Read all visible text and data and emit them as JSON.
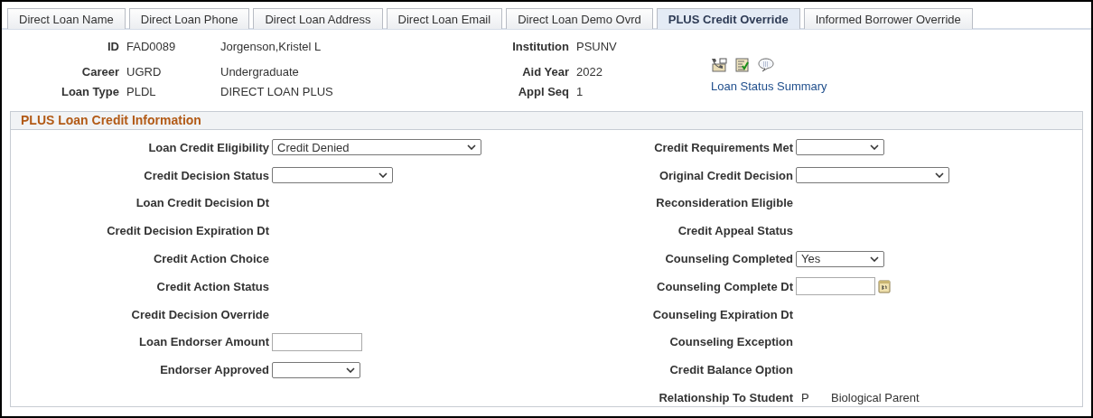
{
  "tabs": [
    {
      "label": "Direct Loan Name",
      "selected": false
    },
    {
      "label": "Direct Loan Phone",
      "selected": false
    },
    {
      "label": "Direct Loan Address",
      "selected": false
    },
    {
      "label": "Direct Loan Email",
      "selected": false
    },
    {
      "label": "Direct Loan Demo Ovrd",
      "selected": false
    },
    {
      "label": "PLUS Credit Override",
      "selected": true
    },
    {
      "label": "Informed Borrower Override",
      "selected": false
    }
  ],
  "header": {
    "left": [
      {
        "label": "ID",
        "code": "FAD0089",
        "description": "Jorgenson,Kristel L"
      },
      {
        "label": "Career",
        "code": "UGRD",
        "description": "Undergraduate"
      },
      {
        "label": "Loan Type",
        "code": "PLDL",
        "description": "DIRECT LOAN PLUS"
      }
    ],
    "right": [
      {
        "label": "Institution",
        "value": "PSUNV"
      },
      {
        "label": "Aid Year",
        "value": "2022"
      },
      {
        "label": "Appl Seq",
        "value": "1"
      }
    ],
    "link": "Loan Status Summary"
  },
  "section": {
    "title": "PLUS Loan Credit Information",
    "left_fields": [
      {
        "label": "Loan Credit Eligibility",
        "kind": "select",
        "value": "Credit Denied"
      },
      {
        "label": "Credit Decision Status",
        "kind": "select"
      },
      {
        "label": "Loan Credit Decision Dt",
        "kind": "display"
      },
      {
        "label": "Credit Decision Expiration Dt",
        "kind": "display"
      },
      {
        "label": "Credit Action Choice",
        "kind": "display"
      },
      {
        "label": "Credit Action Status",
        "kind": "display"
      },
      {
        "label": "Credit Decision Override",
        "kind": "display"
      },
      {
        "label": "Loan Endorser Amount",
        "kind": "text"
      },
      {
        "label": "Endorser Approved",
        "kind": "select"
      }
    ],
    "right_fields": [
      {
        "label": "Credit Requirements Met",
        "kind": "select"
      },
      {
        "label": "Original Credit Decision",
        "kind": "select"
      },
      {
        "label": "Reconsideration Eligible",
        "kind": "display"
      },
      {
        "label": "Credit Appeal Status",
        "kind": "display"
      },
      {
        "label": "Counseling Completed",
        "kind": "select",
        "value": "Yes"
      },
      {
        "label": "Counseling Complete Dt",
        "kind": "date"
      },
      {
        "label": "Counseling Expiration Dt",
        "kind": "display"
      },
      {
        "label": "Counseling Exception",
        "kind": "display"
      },
      {
        "label": "Credit Balance Option",
        "kind": "display"
      },
      {
        "label": "Relationship To Student",
        "kind": "display",
        "value": "P",
        "description": "Biological Parent"
      }
    ]
  }
}
